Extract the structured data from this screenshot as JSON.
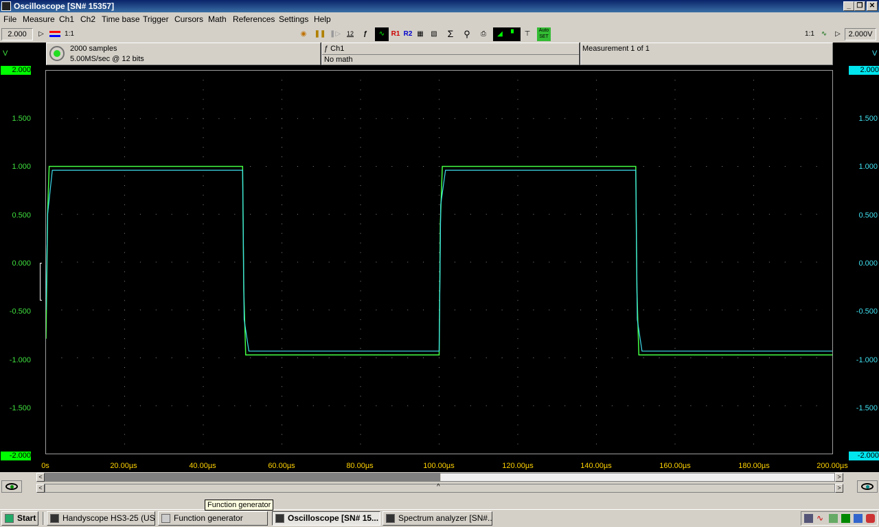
{
  "window": {
    "title": "Oscilloscope  [SN# 15357]"
  },
  "menu": [
    "File",
    "Measure",
    "Ch1",
    "Ch2",
    "Time base",
    "Trigger",
    "Cursors",
    "Math",
    "References",
    "Settings",
    "Help"
  ],
  "toolbar": {
    "left_value": "2.000",
    "ratio_left": "1:1",
    "ratio_right": "1:1",
    "right_value": "2.000V",
    "record_length_icon": "12",
    "ref1": "R1",
    "ref2": "R2",
    "autoset": "Auto SET"
  },
  "info": {
    "samples": "2000 samples",
    "sample_rate": "5.00MS/sec @ 12 bits",
    "channel": "ƒ Ch1",
    "math": "No math",
    "measurement": "Measurement 1 of 1"
  },
  "axes": {
    "left_unit": "V",
    "right_unit": "V",
    "y_ticks": [
      "2.000",
      "1.500",
      "1.000",
      "0.500",
      "0.000",
      "-0.500",
      "-1.000",
      "-1.500",
      "-2.000"
    ],
    "x_ticks": [
      "0s",
      "20.00µs",
      "40.00µs",
      "60.00µs",
      "80.00µs",
      "100.00µs",
      "120.00µs",
      "140.00µs",
      "160.00µs",
      "180.00µs",
      "200.00µs"
    ]
  },
  "colors": {
    "ch1": "#44ff44",
    "ch2": "#3fe0f0",
    "xaxis": "#ffd200",
    "edge_fill_left": "#00ff00",
    "edge_fill_right": "#00e5ee"
  },
  "chart_data": {
    "type": "line",
    "xlim": [
      0,
      200
    ],
    "ylim": [
      -2,
      2
    ],
    "grid": true,
    "series": [
      {
        "x": [
          0,
          0.4,
          0.8,
          50,
          50.3,
          50.8,
          100,
          100.3,
          100.8,
          150,
          150.3,
          150.8,
          200
        ],
        "y": [
          -0.8,
          0.5,
          1.0,
          1.0,
          -0.3,
          -0.97,
          -0.97,
          0.4,
          1.0,
          1.0,
          -0.3,
          -0.97,
          -0.97
        ]
      },
      {
        "x": [
          0,
          0.4,
          1.6,
          50,
          50.4,
          51.6,
          100,
          100.4,
          101.6,
          150,
          150.4,
          151.6,
          200
        ],
        "y": [
          -0.5,
          0.5,
          0.96,
          0.96,
          -0.6,
          -0.93,
          -0.93,
          0.6,
          0.96,
          0.96,
          -0.6,
          -0.93,
          -0.93
        ]
      }
    ]
  },
  "scroll": {
    "left": "<",
    "right": ">",
    "center": "^"
  },
  "tooltip": "Function generator",
  "taskbar": {
    "start": "Start",
    "tasks": [
      "Handyscope HS3-25 (US...",
      "Function generator",
      "Oscilloscope  [SN# 15...",
      "Spectrum analyzer  [SN#..."
    ]
  }
}
